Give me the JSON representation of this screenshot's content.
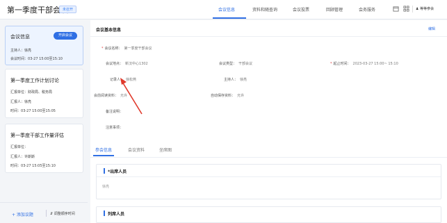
{
  "header": {
    "title": "第一季度干部会议",
    "status_badge": "未召开",
    "tabs": [
      {
        "label": "会议信息",
        "active": true
      },
      {
        "label": "资料和随查询",
        "active": false
      },
      {
        "label": "会议投票",
        "active": false
      },
      {
        "label": "回顾管理",
        "active": false
      },
      {
        "label": "会务服务",
        "active": false
      }
    ],
    "user_name": "等等参会"
  },
  "sidebar": {
    "meeting_card": {
      "title": "会议信息",
      "start_button": "开启会议",
      "host_label": "主持人：",
      "host_value": "徐亮",
      "time_label": "会议时间：",
      "time_value": "03-27 15:00至15:10"
    },
    "agenda": [
      {
        "title": "第一季度工作计划讨论",
        "unit_label": "汇报单位：",
        "unit_value": "财政局、税务局",
        "reporter_label": "汇报人：",
        "reporter_value": "徐亮",
        "time_label": "时间：",
        "time_value": "03-27 15:00至15:05"
      },
      {
        "title": "第一季度干部工作量评估",
        "unit_label": "汇报单位：",
        "unit_value": "",
        "reporter_label": "汇报人：",
        "reporter_value": "许斯斯",
        "time_label": "时间：",
        "time_value": "03-27 15:05至15:10"
      }
    ],
    "footer": {
      "add_label": "+ 添加议题",
      "order_label": "⇵ 调整顺序时间"
    }
  },
  "main": {
    "section_title": "会议基本信息",
    "edit_label": "编辑",
    "fields": {
      "name": {
        "label": "会议名称：",
        "value": "第一季度干部会议"
      },
      "location": {
        "label": "会议地点：",
        "value": "新汉中心1302"
      },
      "type": {
        "label": "会议类型：",
        "value": "干部会议"
      },
      "start_end": {
        "label": "起止时间：",
        "value": "2023-03-27 15:00~ 15:10"
      },
      "recorder": {
        "label": "记录人：",
        "value": "徐松燕"
      },
      "host": {
        "label": "主持人：",
        "value": "徐亮"
      },
      "preview": {
        "label": "会前阅读资料：",
        "value": "允许"
      },
      "auto_save": {
        "label": "自动保存资料：",
        "value": "允许"
      },
      "remark": {
        "label": "备注说明：",
        "value": ""
      },
      "notice": {
        "label": "注意事项：",
        "value": ""
      }
    },
    "subtabs": [
      {
        "label": "参会信息",
        "active": true
      },
      {
        "label": "会议资料",
        "active": false
      },
      {
        "label": "坐席图",
        "active": false
      }
    ],
    "attendees": {
      "title": "*出席人员",
      "placeholder": "徐亮"
    },
    "observers": {
      "title": "列席人员"
    }
  },
  "colors": {
    "accent": "#2f6fe4",
    "required": "#e23b3b",
    "arrow": "#e0392b"
  },
  "icons": [
    "calendar-icon",
    "grid-icon",
    "user-icon",
    "arrow-annotation-icon"
  ]
}
